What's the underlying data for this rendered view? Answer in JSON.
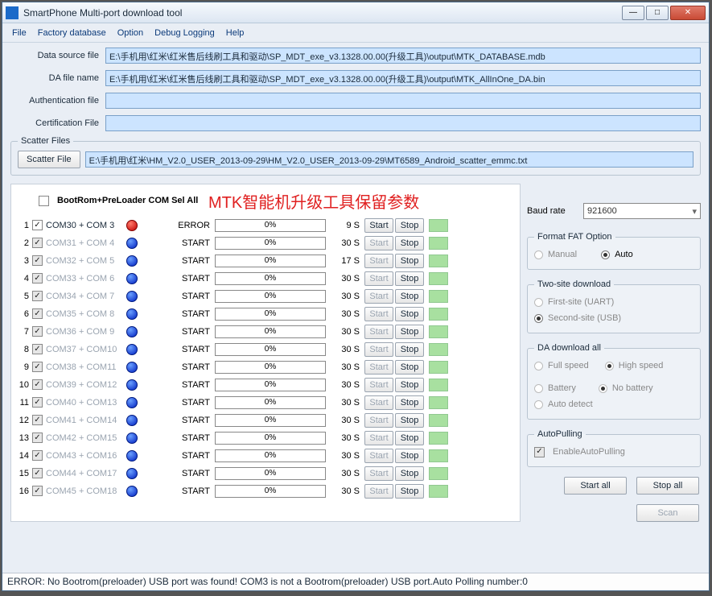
{
  "window": {
    "title": "SmartPhone Multi-port download tool",
    "minimize": "—",
    "maximize": "□",
    "close": "✕"
  },
  "menu": {
    "items": [
      "File",
      "Factory database",
      "Option",
      "Debug Logging",
      "Help"
    ]
  },
  "fields": {
    "data_source_label": "Data source file",
    "data_source_value": "E:\\手机用\\红米\\红米售后线刷工具和驱动\\SP_MDT_exe_v3.1328.00.00(升级工具)\\output\\MTK_DATABASE.mdb",
    "da_label": "DA file name",
    "da_value": "E:\\手机用\\红米\\红米售后线刷工具和驱动\\SP_MDT_exe_v3.1328.00.00(升级工具)\\output\\MTK_AllInOne_DA.bin",
    "auth_label": "Authentication file",
    "auth_value": "",
    "cert_label": "Certification File",
    "cert_value": ""
  },
  "scatter": {
    "legend": "Scatter Files",
    "button": "Scatter File",
    "value": "E:\\手机用\\红米\\HM_V2.0_USER_2013-09-29\\HM_V2.0_USER_2013-09-29\\MT6589_Android_scatter_emmc.txt"
  },
  "ports": {
    "sel_all_label": "BootRom+PreLoader COM Sel All",
    "banner": "MTK智能机升级工具保留参数",
    "start_label": "Start",
    "stop_label": "Stop",
    "rows": [
      {
        "idx": 1,
        "name": "COM30 + COM 3",
        "active": true,
        "dot": "red",
        "status": "ERROR",
        "pct": "0%",
        "time": "9 S"
      },
      {
        "idx": 2,
        "name": "COM31 + COM 4",
        "active": false,
        "dot": "blue",
        "status": "START",
        "pct": "0%",
        "time": "30 S"
      },
      {
        "idx": 3,
        "name": "COM32 + COM 5",
        "active": false,
        "dot": "blue",
        "status": "START",
        "pct": "0%",
        "time": "17 S"
      },
      {
        "idx": 4,
        "name": "COM33 + COM 6",
        "active": false,
        "dot": "blue",
        "status": "START",
        "pct": "0%",
        "time": "30 S"
      },
      {
        "idx": 5,
        "name": "COM34 + COM 7",
        "active": false,
        "dot": "blue",
        "status": "START",
        "pct": "0%",
        "time": "30 S"
      },
      {
        "idx": 6,
        "name": "COM35 + COM 8",
        "active": false,
        "dot": "blue",
        "status": "START",
        "pct": "0%",
        "time": "30 S"
      },
      {
        "idx": 7,
        "name": "COM36 + COM 9",
        "active": false,
        "dot": "blue",
        "status": "START",
        "pct": "0%",
        "time": "30 S"
      },
      {
        "idx": 8,
        "name": "COM37 + COM10",
        "active": false,
        "dot": "blue",
        "status": "START",
        "pct": "0%",
        "time": "30 S"
      },
      {
        "idx": 9,
        "name": "COM38 + COM11",
        "active": false,
        "dot": "blue",
        "status": "START",
        "pct": "0%",
        "time": "30 S"
      },
      {
        "idx": 10,
        "name": "COM39 + COM12",
        "active": false,
        "dot": "blue",
        "status": "START",
        "pct": "0%",
        "time": "30 S"
      },
      {
        "idx": 11,
        "name": "COM40 + COM13",
        "active": false,
        "dot": "blue",
        "status": "START",
        "pct": "0%",
        "time": "30 S"
      },
      {
        "idx": 12,
        "name": "COM41 + COM14",
        "active": false,
        "dot": "blue",
        "status": "START",
        "pct": "0%",
        "time": "30 S"
      },
      {
        "idx": 13,
        "name": "COM42 + COM15",
        "active": false,
        "dot": "blue",
        "status": "START",
        "pct": "0%",
        "time": "30 S"
      },
      {
        "idx": 14,
        "name": "COM43 + COM16",
        "active": false,
        "dot": "blue",
        "status": "START",
        "pct": "0%",
        "time": "30 S"
      },
      {
        "idx": 15,
        "name": "COM44 + COM17",
        "active": false,
        "dot": "blue",
        "status": "START",
        "pct": "0%",
        "time": "30 S"
      },
      {
        "idx": 16,
        "name": "COM45 + COM18",
        "active": false,
        "dot": "blue",
        "status": "START",
        "pct": "0%",
        "time": "30 S"
      }
    ]
  },
  "side": {
    "baud_label": "Baud rate",
    "baud_value": "921600",
    "format_legend": "Format FAT Option",
    "manual": "Manual",
    "auto": "Auto",
    "twosite_legend": "Two-site download",
    "first_site": "First-site (UART)",
    "second_site": "Second-site (USB)",
    "da_legend": "DA download all",
    "full_speed": "Full speed",
    "high_speed": "High speed",
    "battery": "Battery",
    "no_battery": "No battery",
    "auto_detect": "Auto detect",
    "autopull_legend": "AutoPulling",
    "enable_autopull": "EnableAutoPulling",
    "start_all": "Start all",
    "stop_all": "Stop all",
    "scan": "Scan"
  },
  "status_text": "ERROR: No Bootrom(preloader) USB port was found! COM3 is not a Bootrom(preloader) USB port.Auto Polling number:0"
}
